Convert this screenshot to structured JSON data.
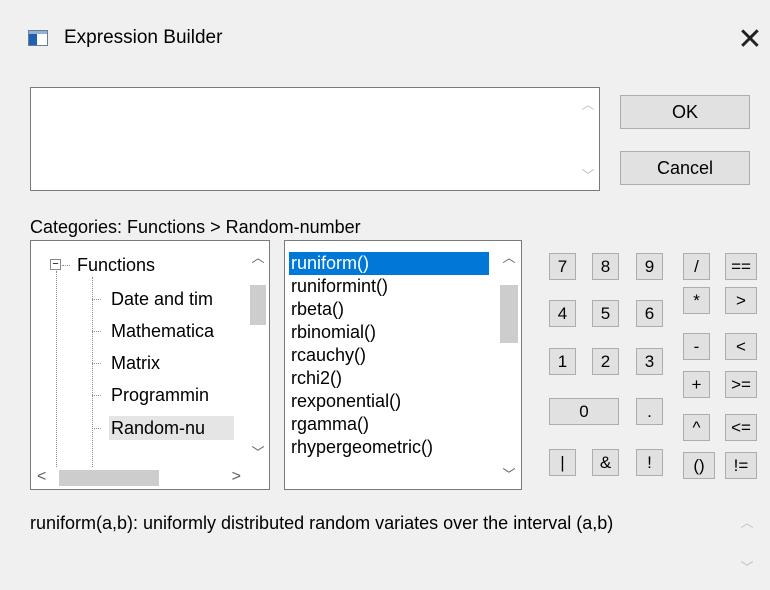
{
  "window": {
    "title": "Expression Builder",
    "close_glyph": "✕"
  },
  "buttons": {
    "ok": "OK",
    "cancel": "Cancel"
  },
  "expression": {
    "value": ""
  },
  "categories": {
    "label": "Categories: Functions > Random-number"
  },
  "tree": {
    "expander_glyph": "−",
    "items": [
      {
        "label": "Functions"
      },
      {
        "label": "Date and tim"
      },
      {
        "label": "Mathematica"
      },
      {
        "label": "Matrix"
      },
      {
        "label": "Programmin"
      },
      {
        "label": "Random-nu"
      }
    ]
  },
  "function_list": {
    "items": [
      {
        "label": "runiform()",
        "selected": true
      },
      {
        "label": "runiformint()"
      },
      {
        "label": "rbeta()"
      },
      {
        "label": "rbinomial()"
      },
      {
        "label": "rcauchy()"
      },
      {
        "label": "rchi2()"
      },
      {
        "label": "rexponential()"
      },
      {
        "label": "rgamma()"
      },
      {
        "label": "rhypergeometric()"
      }
    ]
  },
  "keypad": {
    "k7": "7",
    "k8": "8",
    "k9": "9",
    "k4": "4",
    "k5": "5",
    "k6": "6",
    "k1": "1",
    "k2": "2",
    "k3": "3",
    "k0": "0",
    "dot": ".",
    "pipe": "|",
    "amp": "&",
    "bang": "!",
    "div": "/",
    "eq": "==",
    "mul": "*",
    "gt": ">",
    "sub": "-",
    "lt": "<",
    "add": "+",
    "ge": ">=",
    "pow": "^",
    "le": "<=",
    "paren": "()",
    "ne": "!="
  },
  "description": {
    "text": "runiform(a,b):  uniformly distributed random variates over the interval (a,b)"
  },
  "icons": {
    "up": "︿",
    "down": "﹀",
    "left": "<",
    "right": ">"
  }
}
